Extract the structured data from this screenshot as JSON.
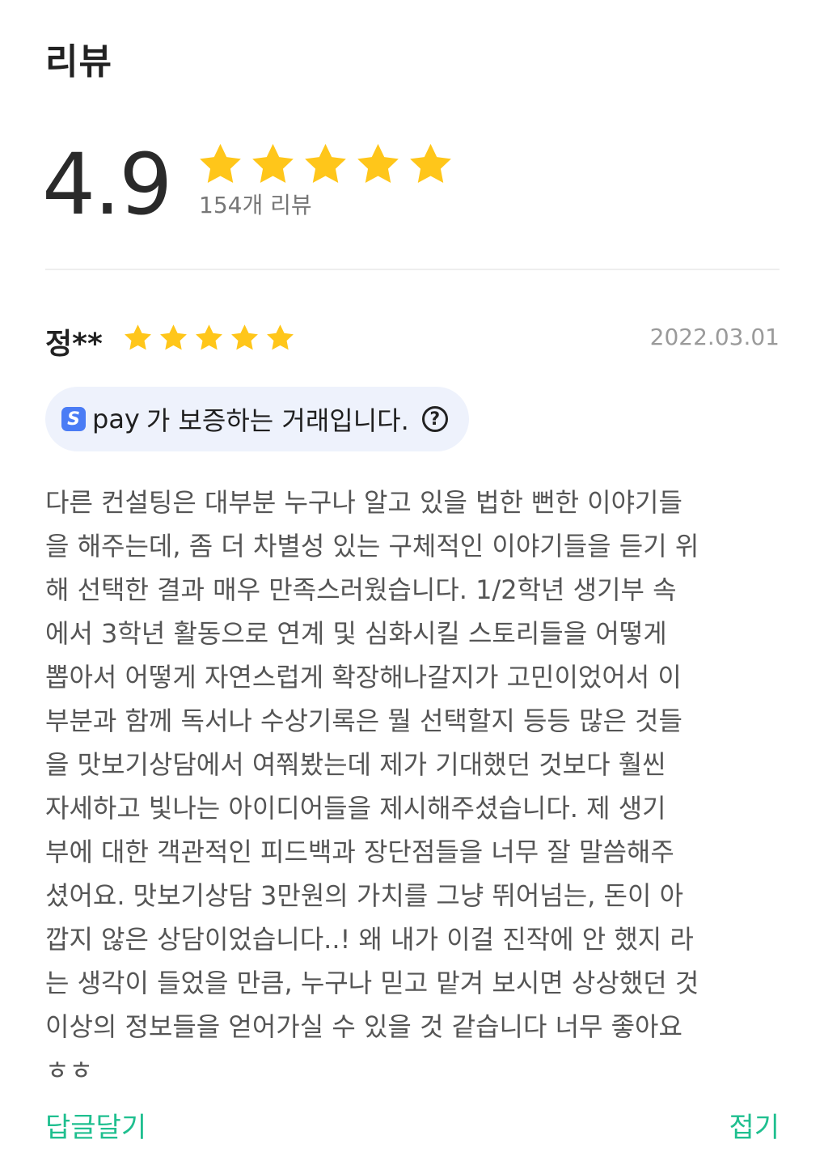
{
  "header": {
    "title": "리뷰"
  },
  "summary": {
    "average": "4.9",
    "rating": 5,
    "review_count": "154개 리뷰"
  },
  "review": {
    "reviewer": "정**",
    "rating": 5,
    "date": "2022.03.01",
    "pay_badge": {
      "logo": "S",
      "brand": "pay",
      "text": "가 보증하는 거래입니다.",
      "help": "?"
    },
    "body": "다른 컨설팅은 대부분 누구나 알고 있을 법한 뻔한 이야기들\n을 해주는데, 좀 더 차별성 있는 구체적인 이야기들을 듣기 위\n해 선택한 결과 매우 만족스러웠습니다. 1/2학년 생기부 속\n에서 3학년 활동으로 연계 및 심화시킬 스토리들을 어떻게\n뽑아서 어떻게 자연스럽게 확장해나갈지가 고민이었어서 이\n부분과 함께 독서나 수상기록은 뭘 선택할지 등등 많은 것들\n을 맛보기상담에서 여쭤봤는데 제가 기대했던 것보다 훨씬\n자세하고 빛나는 아이디어들을 제시해주셨습니다. 제 생기\n부에 대한 객관적인 피드백과 장단점들을 너무 잘 말씀해주\n셨어요. 맛보기상담 3만원의 가치를 그냥 뛰어넘는, 돈이 아\n깝지 않은 상담이었습니다..! 왜 내가 이걸 진작에 안 했지 라\n는 생각이 들었을 만큼, 누구나 믿고 맡겨 보시면 상상했던 것\n이상의 정보들을 얻어가실 수 있을 것 같습니다 너무 좋아요\nㅎㅎ"
  },
  "footer": {
    "reply": "답글달기",
    "collapse": "접기"
  },
  "colors": {
    "star": "#FFC61A",
    "accent": "#1FBF8F",
    "badge_bg": "#EEF2FC",
    "pay_logo": "#4A7CF5"
  }
}
